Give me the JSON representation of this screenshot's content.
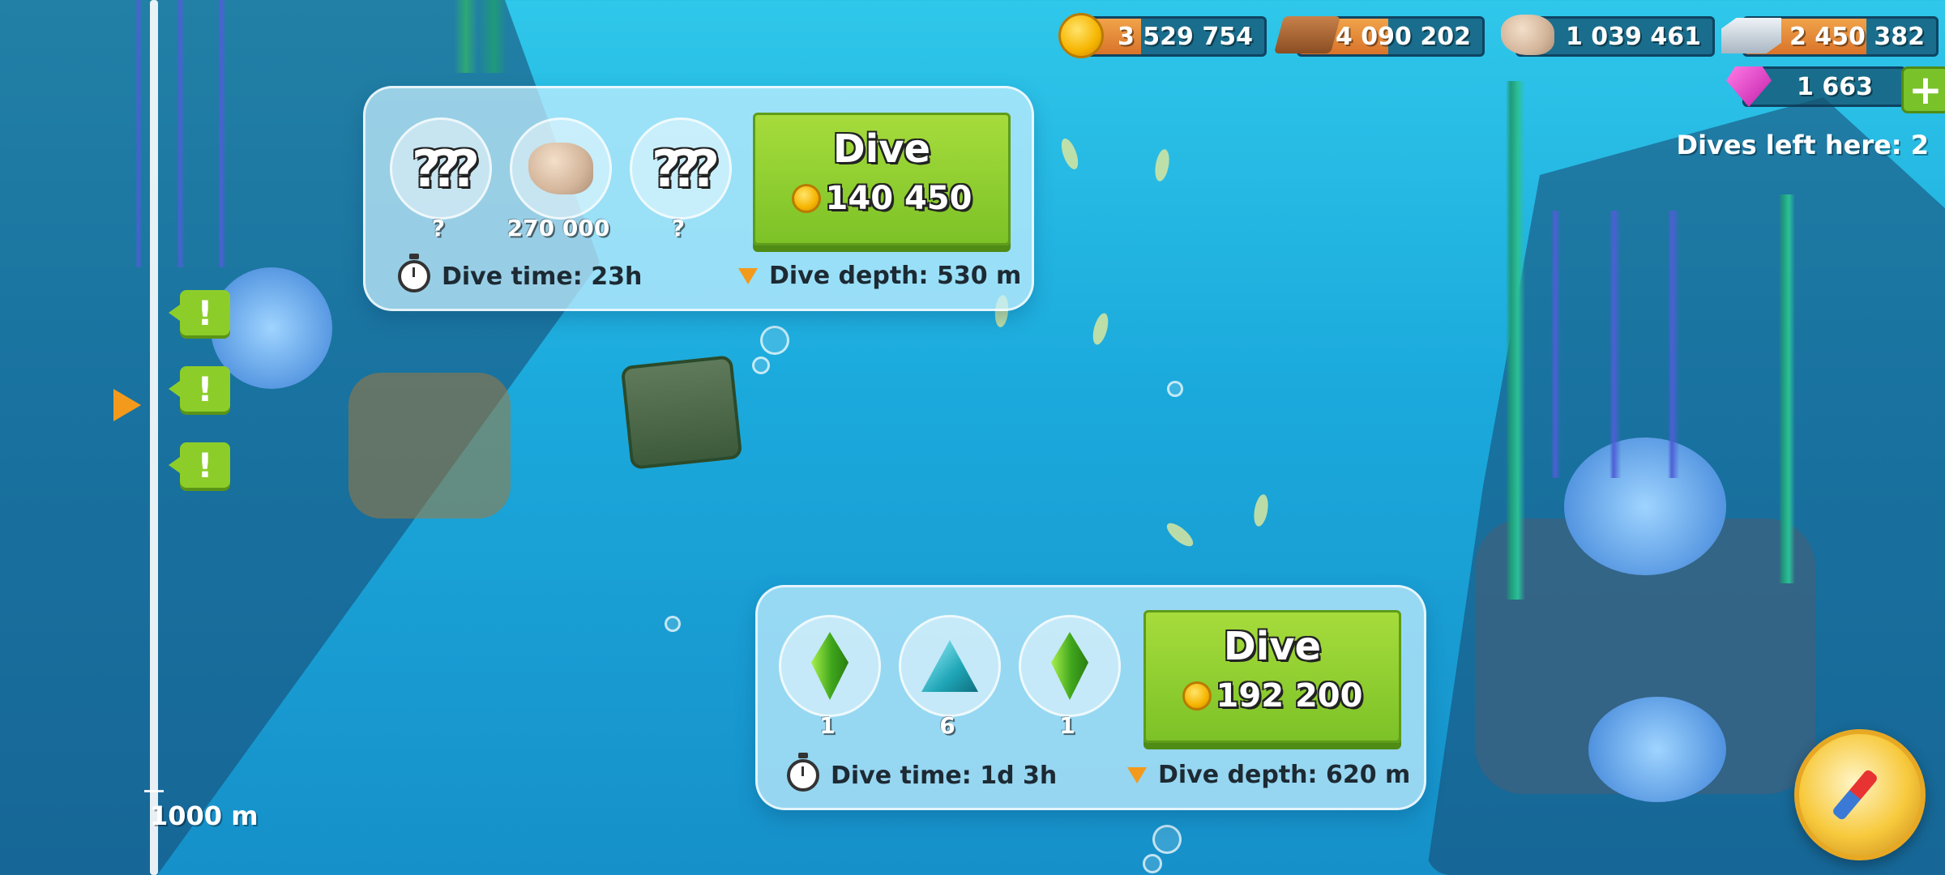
{
  "resources": {
    "coins": "3 529 754",
    "wood": "4 090 202",
    "stone": "1 039 461",
    "iron": "2 450 382",
    "gems": "1 663"
  },
  "dives_left": "Dives left here: 2",
  "depth_gauge": {
    "label": "1000 m"
  },
  "alerts": [
    "!",
    "!",
    "!"
  ],
  "dive_panels": [
    {
      "rewards": [
        {
          "icon": "mystery-reward-icon",
          "label": "?"
        },
        {
          "icon": "stone-icon",
          "label": "270 000"
        },
        {
          "icon": "mystery-reward-icon",
          "label": "?"
        }
      ],
      "button_label": "Dive",
      "cost": "140 450",
      "time": "Dive time: 23h",
      "depth": "Dive depth: 530 m"
    },
    {
      "rewards": [
        {
          "icon": "green-crystal-icon",
          "label": "1"
        },
        {
          "icon": "blue-crystal-icon",
          "label": "6"
        },
        {
          "icon": "green-crystal-icon",
          "label": "1"
        }
      ],
      "button_label": "Dive",
      "cost": "192 200",
      "time": "Dive time: 1d 3h",
      "depth": "Dive depth: 620 m"
    }
  ],
  "colors": {
    "water": "#1ba9dc",
    "button_green": "#7cc227",
    "resource_orange": "#d9732a",
    "marker_orange": "#f39a1c"
  }
}
